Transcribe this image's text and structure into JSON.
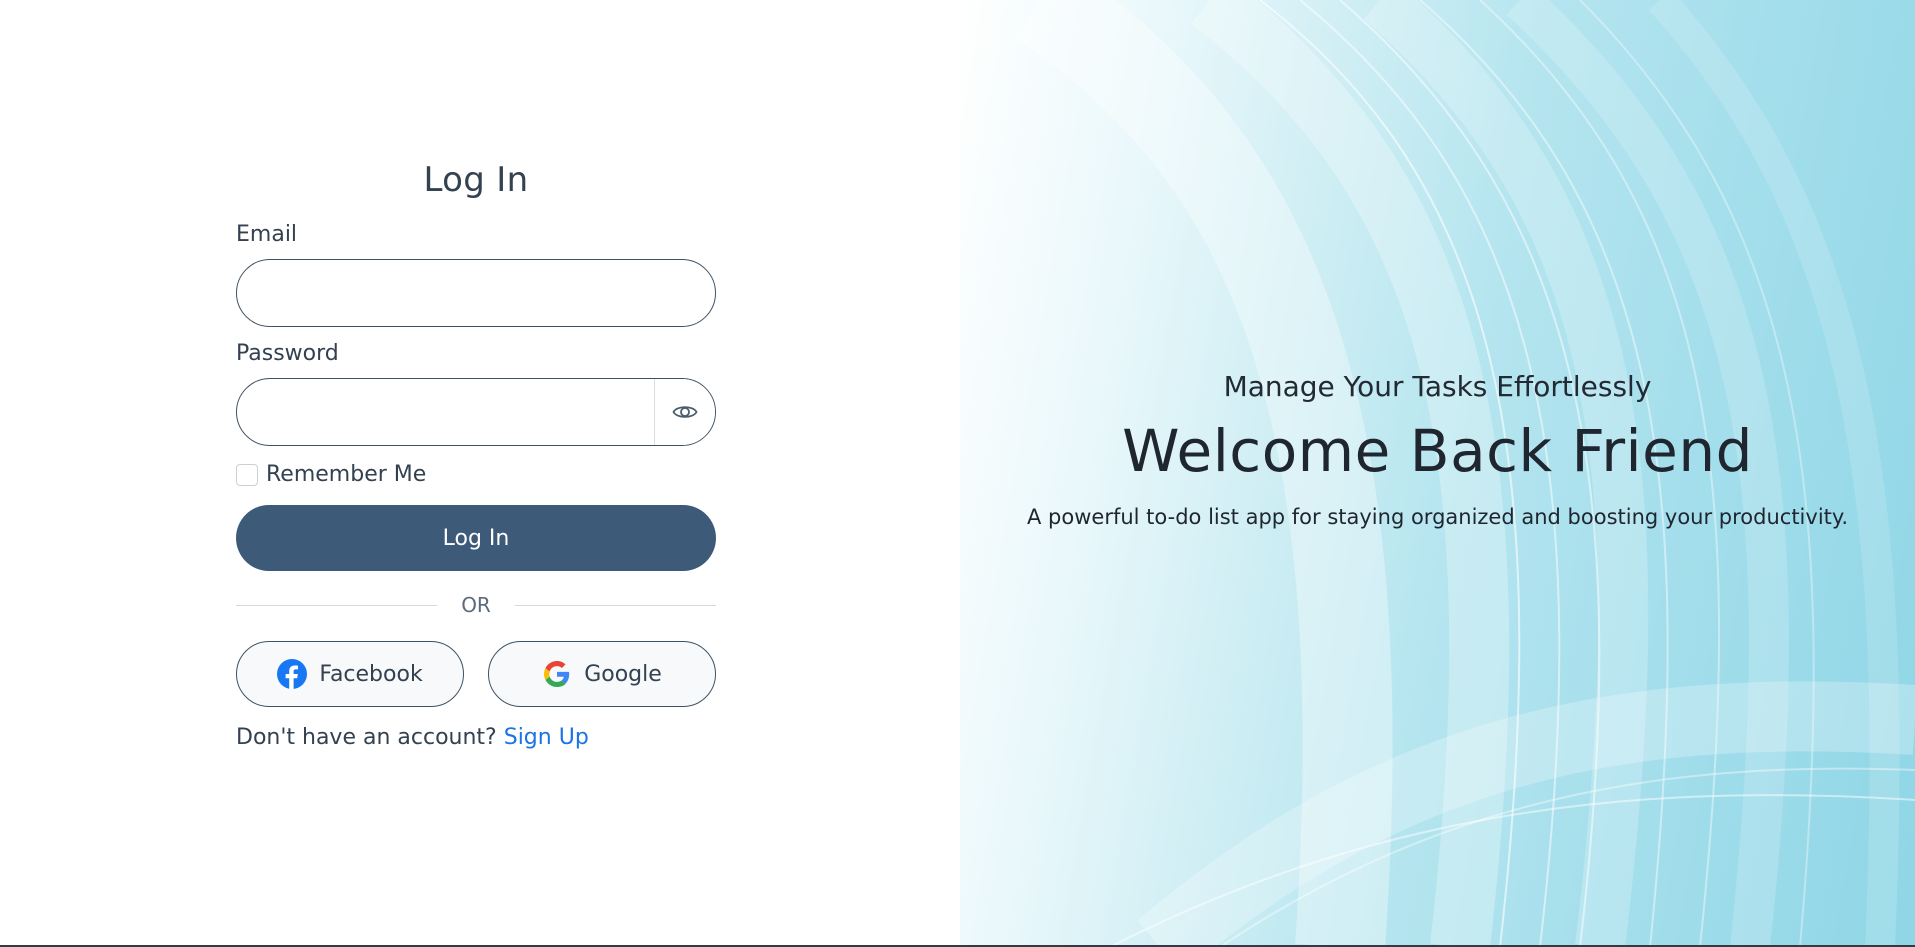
{
  "login": {
    "title": "Log In",
    "email_label": "Email",
    "email_value": "",
    "password_label": "Password",
    "password_value": "",
    "remember_label": "Remember Me",
    "submit_label": "Log In",
    "divider_text": "OR",
    "facebook_label": "Facebook",
    "google_label": "Google",
    "signup_prompt": "Don't have an account?",
    "signup_link": "Sign Up"
  },
  "hero": {
    "subtitle": "Manage Your Tasks Effortlessly",
    "title": "Welcome Back Friend",
    "description": "A powerful to-do list app for staying organized and boosting your productivity."
  },
  "colors": {
    "primary": "#3d5b78",
    "link": "#1b74e4",
    "facebook": "#1877f2"
  },
  "icons": {
    "password_toggle": "eye-icon",
    "facebook": "facebook-icon",
    "google": "google-icon"
  }
}
